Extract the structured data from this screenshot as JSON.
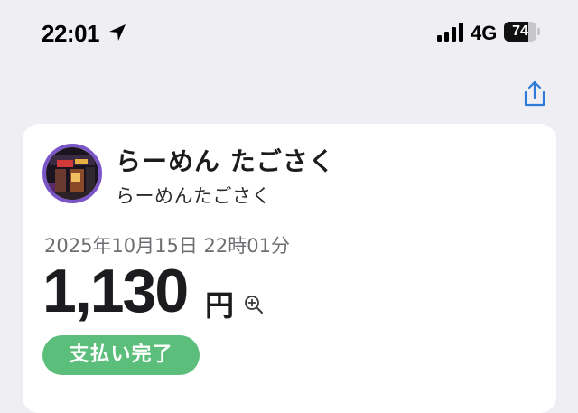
{
  "status_bar": {
    "time": "22:01",
    "network": "4G",
    "battery": "74",
    "battery_level": 0.74,
    "icons": [
      "location-arrow-icon",
      "signal-bars-icon",
      "battery-icon"
    ]
  },
  "toolbar": {
    "share_icon": "share-icon"
  },
  "payment": {
    "store_name": "らーめん たごさく",
    "store_subname": "らーめんたごさく",
    "datetime": "2025年10月15日 22時01分",
    "amount": "1,130",
    "currency": "円",
    "zoom_icon": "zoom-in-icon",
    "status": "支払い完了"
  },
  "colors": {
    "accent_green": "#5bbf7b",
    "avatar_ring": "#7a56c8",
    "link_blue": "#2f7bd8",
    "background": "#eeeef3"
  }
}
